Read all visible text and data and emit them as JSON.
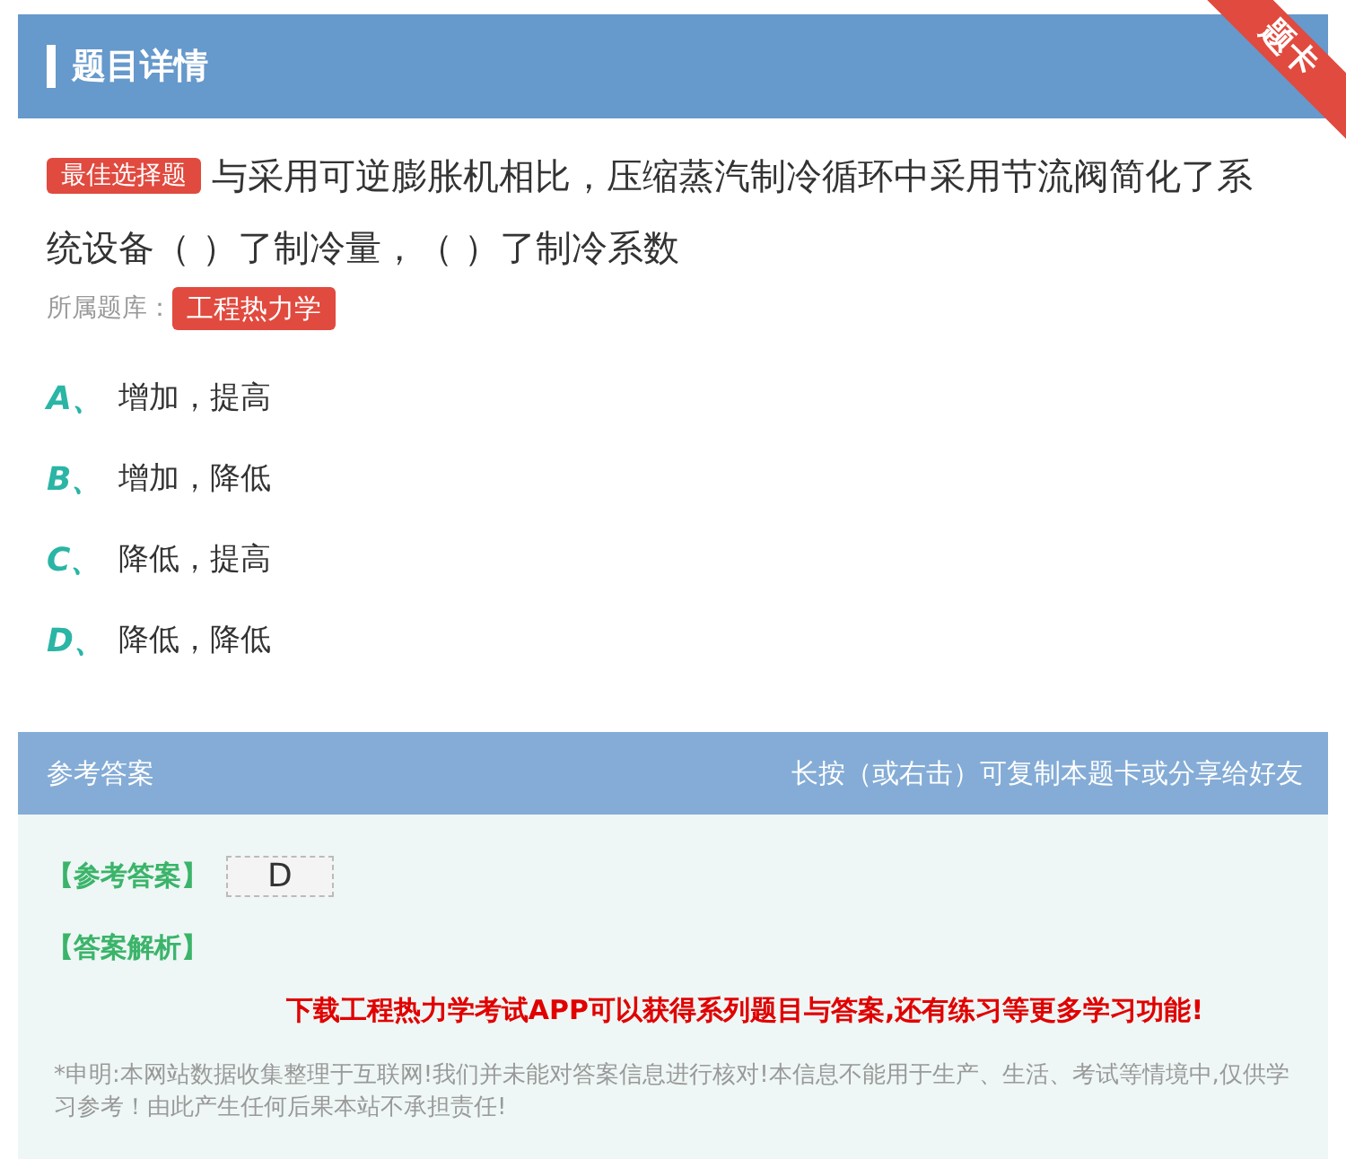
{
  "header": {
    "title": "题目详情",
    "ribbon": "题卡"
  },
  "question": {
    "type_tag": "最佳选择题",
    "text": "与采用可逆膨胀机相比，压缩蒸汽制冷循环中采用节流阀简化了系统设备（ ）了制冷量，（ ）了制冷系数",
    "bank_label": "所属题库：",
    "bank_tag": "工程热力学"
  },
  "options": [
    {
      "letter": "A、",
      "text": "增加，提高"
    },
    {
      "letter": "B、",
      "text": "增加，降低"
    },
    {
      "letter": "C、",
      "text": "降低，提高"
    },
    {
      "letter": "D、",
      "text": "降低，降低"
    }
  ],
  "answer_section": {
    "title": "参考答案",
    "hint": "长按（或右击）可复制本题卡或分享给好友",
    "answer_label": "【参考答案】",
    "answer": "D",
    "analysis_label": "【答案解析】",
    "promo": "下载工程热力学考试APP可以获得系列题目与答案,还有练习等更多学习功能!",
    "disclaimer": "*申明:本网站数据收集整理于互联网!我们并未能对答案信息进行核对!本信息不能用于生产、生活、考试等情境中,仅供学习参考！由此产生任何后果本站不承担责任!"
  }
}
